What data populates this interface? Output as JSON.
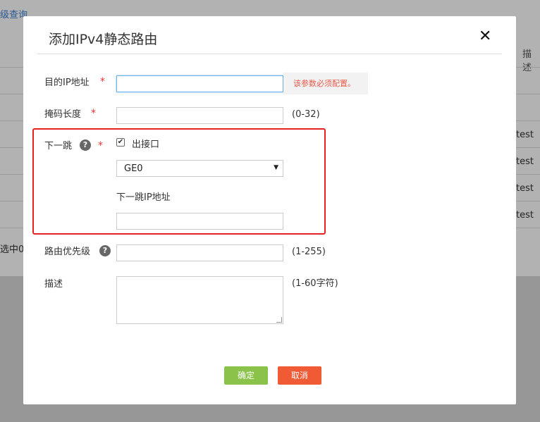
{
  "background": {
    "link_text": "级查询",
    "column_header": "描述",
    "row_values": [
      "test",
      "test",
      "test",
      "test"
    ],
    "selected_text": "选中0,"
  },
  "dialog": {
    "title": "添加IPv4静态路由",
    "close_icon": "close-icon",
    "fields": {
      "dest_ip": {
        "label": "目的IP地址",
        "required_mark": "*",
        "value": "",
        "error": "该参数必须配置。"
      },
      "mask_length": {
        "label": "掩码长度",
        "required_mark": "*",
        "value": "",
        "hint": "(0-32)"
      },
      "next_hop": {
        "label": "下一跳",
        "help_glyph": "?",
        "required_mark": "*",
        "outgoing_checkbox_label": "出接口",
        "outgoing_checked": true,
        "interface_selected": "GE0",
        "next_hop_ip_label": "下一跳IP地址",
        "next_hop_ip_value": ""
      },
      "priority": {
        "label": "路由优先级",
        "help_glyph": "?",
        "value": "",
        "hint": "(1-255)"
      },
      "description": {
        "label": "描述",
        "value": "",
        "hint": "(1-60字符)"
      }
    },
    "buttons": {
      "ok": "确定",
      "cancel": "取消"
    }
  },
  "colors": {
    "ok_button": "#8bc34a",
    "cancel_button": "#f05a35",
    "highlight_border": "#e52222",
    "error_text": "#e95a4a",
    "required_mark": "#e33"
  }
}
